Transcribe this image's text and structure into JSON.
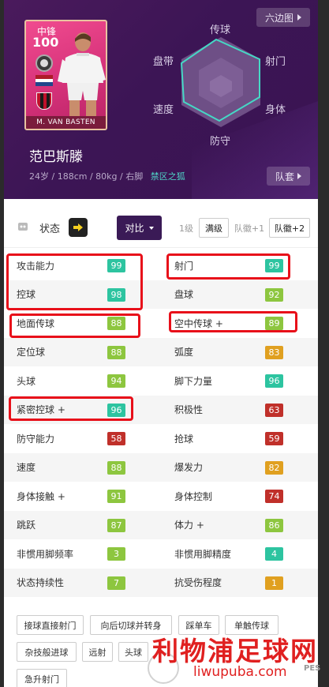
{
  "header": {
    "hex_button": "六边图",
    "team_button": "队套",
    "player_name": "范巴斯滕",
    "player_info": "24岁 / 188cm / 80kg / 右脚",
    "player_skill": "禁区之狐"
  },
  "card": {
    "position": "中锋",
    "rating": "100",
    "name": "M. VAN BASTEN"
  },
  "radar": {
    "labels": [
      "传球",
      "射门",
      "身体",
      "防守",
      "速度",
      "盘带"
    ]
  },
  "toolbar": {
    "status_label": "状态",
    "compare_label": "对比",
    "levels": [
      "1级",
      "满级",
      "队徽+1",
      "队徽+2"
    ]
  },
  "stats": [
    {
      "left": {
        "label": "攻击能力",
        "value": "99",
        "color": "#2dc4a0"
      },
      "right": {
        "label": "射门",
        "value": "99",
        "color": "#2dc4a0"
      }
    },
    {
      "left": {
        "label": "控球",
        "value": "98",
        "color": "#2dc4a0"
      },
      "right": {
        "label": "盘球",
        "value": "92",
        "color": "#8dc63f"
      }
    },
    {
      "left": {
        "label": "地面传球",
        "value": "88",
        "color": "#8dc63f"
      },
      "right": {
        "label": "空中传球 +",
        "value": "89",
        "color": "#8dc63f"
      }
    },
    {
      "left": {
        "label": "定位球",
        "value": "88",
        "color": "#8dc63f"
      },
      "right": {
        "label": "弧度",
        "value": "83",
        "color": "#e0a020"
      }
    },
    {
      "left": {
        "label": "头球",
        "value": "94",
        "color": "#8dc63f"
      },
      "right": {
        "label": "脚下力量",
        "value": "96",
        "color": "#2dc4a0"
      }
    },
    {
      "left": {
        "label": "紧密控球 +",
        "value": "96",
        "color": "#2dc4a0"
      },
      "right": {
        "label": "积极性",
        "value": "63",
        "color": "#c0302a"
      }
    },
    {
      "left": {
        "label": "防守能力",
        "value": "58",
        "color": "#c0302a"
      },
      "right": {
        "label": "抢球",
        "value": "59",
        "color": "#c0302a"
      }
    },
    {
      "left": {
        "label": "速度",
        "value": "88",
        "color": "#8dc63f"
      },
      "right": {
        "label": "爆发力",
        "value": "82",
        "color": "#e0a020"
      }
    },
    {
      "left": {
        "label": "身体接触 +",
        "value": "91",
        "color": "#8dc63f"
      },
      "right": {
        "label": "身体控制",
        "value": "74",
        "color": "#c0302a"
      }
    },
    {
      "left": {
        "label": "跳跃",
        "value": "87",
        "color": "#8dc63f"
      },
      "right": {
        "label": "体力 +",
        "value": "86",
        "color": "#8dc63f"
      }
    },
    {
      "left": {
        "label": "非惯用脚频率",
        "value": "3",
        "color": "#8dc63f"
      },
      "right": {
        "label": "非惯用脚精度",
        "value": "4",
        "color": "#2dc4a0"
      }
    },
    {
      "left": {
        "label": "状态持续性",
        "value": "7",
        "color": "#8dc63f"
      },
      "right": {
        "label": "抗受伤程度",
        "value": "1",
        "color": "#e0a020"
      }
    }
  ],
  "skills": [
    "接球直接射门",
    "向后切球并转身",
    "踩单车",
    "单触传球",
    "杂技般进球",
    "远射",
    "头球",
    "急升射门"
  ],
  "watermark": {
    "text": "利物浦足球网",
    "url": "liwupuba.com",
    "pes": "PES"
  }
}
